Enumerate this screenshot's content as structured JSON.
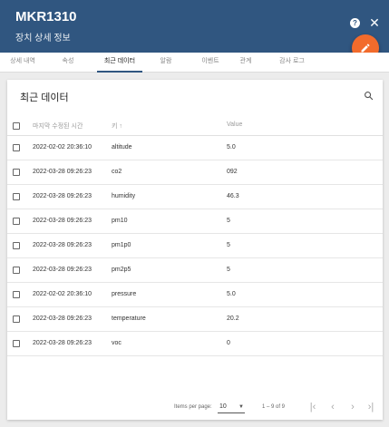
{
  "header": {
    "title": "MKR1310",
    "subtitle": "장치 상세 정보",
    "help_icon": "?",
    "close_icon": "✕"
  },
  "tabs": [
    {
      "label": "상세 내역"
    },
    {
      "label": "속성"
    },
    {
      "label": "최근 데이터",
      "active": true
    },
    {
      "label": "알람"
    },
    {
      "label": "이벤트"
    },
    {
      "label": "관계"
    },
    {
      "label": "감사 로그"
    }
  ],
  "card": {
    "title": "최근 데이터",
    "columns": {
      "time": "마지막 수정된 시간",
      "key": "키 ↑",
      "value": "Value"
    },
    "rows": [
      {
        "time": "2022-02-02 20:36:10",
        "key": "altitude",
        "value": "5.0"
      },
      {
        "time": "2022-03-28 09:26:23",
        "key": "co2",
        "value": "092"
      },
      {
        "time": "2022-03-28 09:26:23",
        "key": "humidity",
        "value": "46.3"
      },
      {
        "time": "2022-03-28 09:26:23",
        "key": "pm10",
        "value": "5"
      },
      {
        "time": "2022-03-28 09:26:23",
        "key": "pm1p0",
        "value": "5"
      },
      {
        "time": "2022-03-28 09:26:23",
        "key": "pm2p5",
        "value": "5"
      },
      {
        "time": "2022-02-02 20:36:10",
        "key": "pressure",
        "value": "5.0"
      },
      {
        "time": "2022-03-28 09:26:23",
        "key": "temperature",
        "value": "20.2"
      },
      {
        "time": "2022-03-28 09:26:23",
        "key": "voc",
        "value": "0"
      }
    ]
  },
  "pagination": {
    "items_per_page_label": "Items per page:",
    "items_per_page": "10",
    "range": "1 – 9 of 9",
    "first": "|‹",
    "prev": "‹",
    "next": "›",
    "last": "›|"
  },
  "colors": {
    "header": "#305680",
    "accent": "#f26b2c"
  }
}
